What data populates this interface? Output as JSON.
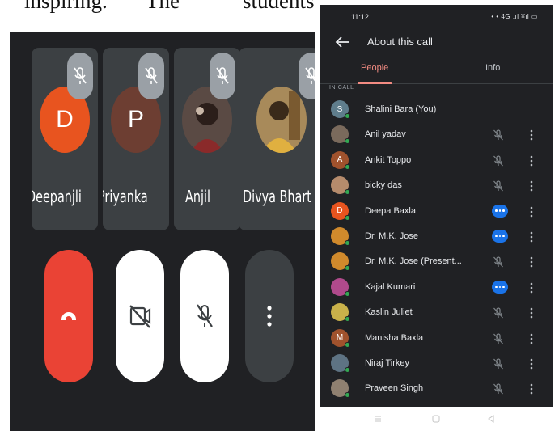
{
  "document": {
    "words": [
      "inspiring.",
      "The",
      "students"
    ]
  },
  "call_screen": {
    "tiles": [
      {
        "name": "Deepanjli",
        "initial": "D",
        "color": "#e8541f",
        "kind": "initial"
      },
      {
        "name": "Priyanka",
        "initial": "P",
        "color": "#6d3e32",
        "kind": "initial"
      },
      {
        "name": "Anjil",
        "initial": "",
        "color": "#6b5a52",
        "kind": "photo"
      },
      {
        "name": "Divya Bhart",
        "initial": "",
        "color": "#8a6a3a",
        "kind": "photo"
      }
    ],
    "controls": [
      "end-call",
      "camera-off",
      "mic-off",
      "more"
    ]
  },
  "phone": {
    "status_time": "11:12",
    "status_right": "• • 4G .ıl ¥ıl ▭",
    "title": "About this call",
    "tabs": {
      "people": "People",
      "info": "Info"
    },
    "section_label": "IN CALL",
    "participants": [
      {
        "name": "Shalini Bara (You)",
        "initial": "S",
        "color": "#5f7d8c",
        "status": "none"
      },
      {
        "name": "Anil yadav",
        "initial": "",
        "color": "#7a6a5c",
        "status": "muted"
      },
      {
        "name": "Ankit Toppo",
        "initial": "A",
        "color": "#a0522d",
        "status": "muted"
      },
      {
        "name": "bicky das",
        "initial": "",
        "color": "#b58b6c",
        "status": "muted"
      },
      {
        "name": "Deepa Baxla",
        "initial": "D",
        "color": "#e8541f",
        "status": "talking"
      },
      {
        "name": "Dr. M.K. Jose",
        "initial": "",
        "color": "#d08a2c",
        "status": "talking"
      },
      {
        "name": "Dr. M.K. Jose (Present...",
        "initial": "",
        "color": "#d08a2c",
        "status": "muted"
      },
      {
        "name": "Kajal Kumari",
        "initial": "",
        "color": "#b04a8c",
        "status": "talking"
      },
      {
        "name": "Kaslin Juliet",
        "initial": "",
        "color": "#c9b14a",
        "status": "muted"
      },
      {
        "name": "Manisha Baxla",
        "initial": "M",
        "color": "#a0522d",
        "status": "muted"
      },
      {
        "name": "Niraj Tirkey",
        "initial": "",
        "color": "#5e7383",
        "status": "muted"
      },
      {
        "name": "Praveen Singh",
        "initial": "",
        "color": "#8f8070",
        "status": "muted"
      }
    ]
  }
}
